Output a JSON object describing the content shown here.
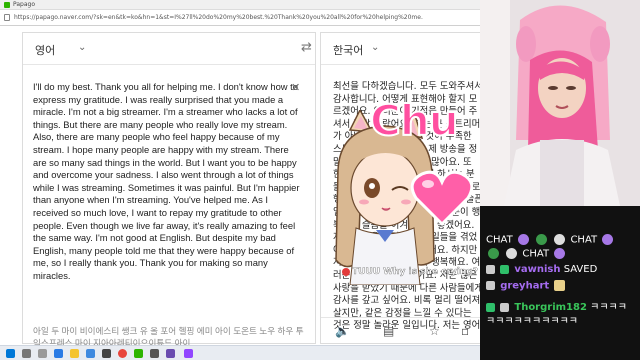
{
  "browser": {
    "tab_title": "Papago",
    "url": "https://papago.naver.com/?sk=en&tk=ko&hn=1&st=I%27ll%20do%20my%20best.%20Thank%20you%20all%20for%20helping%20me."
  },
  "translator": {
    "source_lang": "영어",
    "target_lang": "한국어",
    "source_text": "I'll do my best. Thank you all for helping me. I don't know how to express my gratitude. I was really surprised that you made a miracle. I'm not a big streamer. I'm a streamer who lacks a lot of things. But there are many people who really love my stream. Also, there are many people who feel happy because of my stream. I hope many people are happy with my stream. There are so many sad things in the world. But I want you to be happy and overcome your sadness. I also went through a lot of things while I was streaming. Sometimes it was painful. But I'm happier than anyone when I'm streaming. You've helped me. As I received so much love, I want to repay my gratitude to other people. Even though we live far away, it's really amazing to feel the same way. I'm not good at English. But despite my bad English, many people told me that they were happy because of me, so I really thank you. Thank you for making so many miracles.",
    "romanization": "아일 두 마이 비이에스티 쌩크 유 올 포어 헬핑 에미 아이 도온트 노우 하우 투 익스프레스 마이 지아아레티이으이튜드 아이",
    "target_text": "최선을 다하겠습니다. 모두 도와주셔서 감사합니다. 어떻게 표현해야 할지 모르겠어요. 여러분이 기적을 만들어 주셔서 정말 놀랐어요. 저는 큰 스트리머가 아니에요. 저는 많은 것이 부족한 스트리머입니다. 하지만 제 방송을 정말 사랑해 주시는 분들이 많아요. 또한, 제 방송 덕분에 행복해 하시는 분들도 많아요. 많은 분들이 제 방송으로 행복하셨으면 좋겠어요. 세상에는 슬픈 일이 너무 많아요. 하지만 여러분이 행복하고 슬픔을 이겨냈으면 좋겠어요. 저도 방송을 하면서 많은 일들을 겪었어요. 가끔은 고통스러웠어요. 하지만 저는 방송할 때 누구보다 행복해요. 여러분이 저를 도와주셨어요. 저는 많은 사랑을 받았기 때문에 다른 사람들에게 감사를 갚고 싶어요. 비록 멀리 떨어져 살지만, 같은 감정을 느낄 수 있다는 것은 정말 놀라운 일입니다. 저는 영어를 잘 못해요. 하지만 제 영어가 서툴러도 많은 사람들이 저 때문에 행복하다고 말해 주셔서 정말 감사해요. 많은 기적을 만들어 주셔서 고마워"
  },
  "overlay": {
    "chu_text": "Chu",
    "alert_user": "TUUU",
    "alert_message": "Why is she crying?"
  },
  "chat": {
    "lines": [
      {
        "segments": [
          "CHAT",
          "CHAT"
        ]
      },
      {
        "segments": [
          "CHAT"
        ]
      },
      {
        "user": "vawnish",
        "msg": "SAVED"
      },
      {
        "user": "greyhart",
        "msg": ""
      },
      {
        "user": "Thorgrim182",
        "msg": "ㅋㅋㅋㅋ"
      },
      {
        "msg": "ㅋㅋㅋㅋㅋㅋㅋㅋㅋㅋ"
      }
    ]
  },
  "colors": {
    "accent_pink": "#ff4fa0",
    "chat_bg": "#111111",
    "username_purple": "#a56cf0",
    "username_green": "#39c55a"
  }
}
